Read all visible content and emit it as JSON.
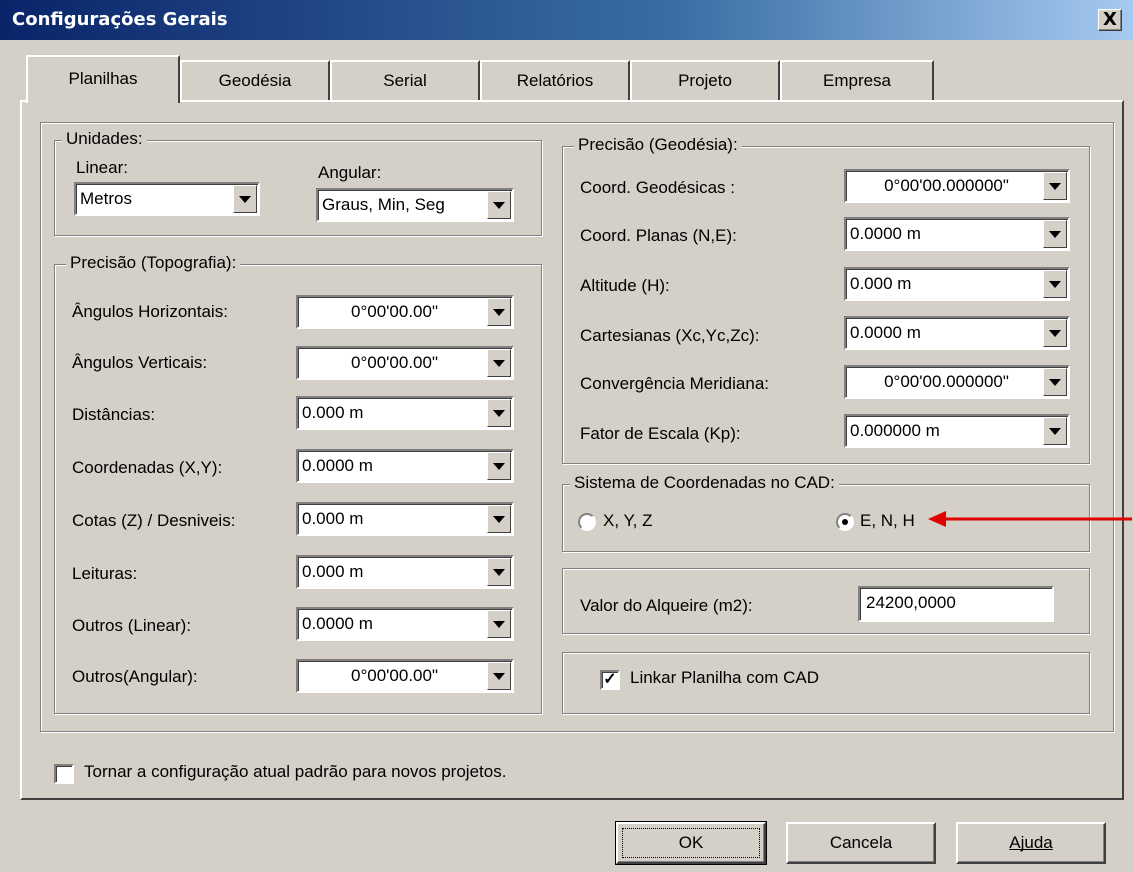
{
  "window": {
    "title": "Configurações Gerais",
    "close_label": "X"
  },
  "tabs": [
    {
      "label": "Planilhas"
    },
    {
      "label": "Geodésia"
    },
    {
      "label": "Serial"
    },
    {
      "label": "Relatórios"
    },
    {
      "label": "Projeto"
    },
    {
      "label": "Empresa"
    }
  ],
  "unidades": {
    "legend": "Unidades:",
    "linear_label": "Linear:",
    "linear_value": "Metros",
    "angular_label": "Angular:",
    "angular_value": "Graus, Min, Seg"
  },
  "topografia": {
    "legend": "Precisão (Topografia):",
    "rows": [
      {
        "label": "Ângulos Horizontais:",
        "value": "0°00'00.00\""
      },
      {
        "label": "Ângulos Verticais:",
        "value": "0°00'00.00\""
      },
      {
        "label": "Distâncias:",
        "value": "0.000 m"
      },
      {
        "label": "Coordenadas (X,Y):",
        "value": "0.0000 m"
      },
      {
        "label": "Cotas (Z) / Desniveis:",
        "value": "0.000 m"
      },
      {
        "label": "Leituras:",
        "value": "0.000 m"
      },
      {
        "label": "Outros (Linear):",
        "value": "0.0000 m"
      },
      {
        "label": "Outros(Angular):",
        "value": "0°00'00.00\""
      }
    ]
  },
  "geodesia": {
    "legend": "Precisão (Geodésia):",
    "rows": [
      {
        "label": "Coord. Geodésicas :",
        "value": "0°00'00.000000\""
      },
      {
        "label": "Coord. Planas (N,E):",
        "value": "0.0000 m"
      },
      {
        "label": "Altitude (H):",
        "value": "0.000 m"
      },
      {
        "label": "Cartesianas (Xc,Yc,Zc):",
        "value": "0.0000 m"
      },
      {
        "label": "Convergência Meridiana:",
        "value": "0°00'00.000000\""
      },
      {
        "label": "Fator de Escala (Kp):",
        "value": "0.000000 m"
      }
    ]
  },
  "cad_system": {
    "legend": "Sistema de Coordenadas no CAD:",
    "option_xyz": "X, Y, Z",
    "option_enh": "E, N, H",
    "selected": "E, N, H"
  },
  "alqueire": {
    "label": "Valor do Alqueire (m2):",
    "value": "24200,0000"
  },
  "link": {
    "label": "Linkar Planilha com CAD",
    "checked": true,
    "check_glyph": "✓"
  },
  "default_config": {
    "label": "Tornar a configuração atual padrão para novos projetos.",
    "checked": false
  },
  "buttons": {
    "ok": "OK",
    "cancel": "Cancela",
    "help": "Ajuda"
  },
  "colors": {
    "titlebar": "#0a246a",
    "face": "#d4d0c8",
    "annotation_arrow": "#e00000"
  }
}
